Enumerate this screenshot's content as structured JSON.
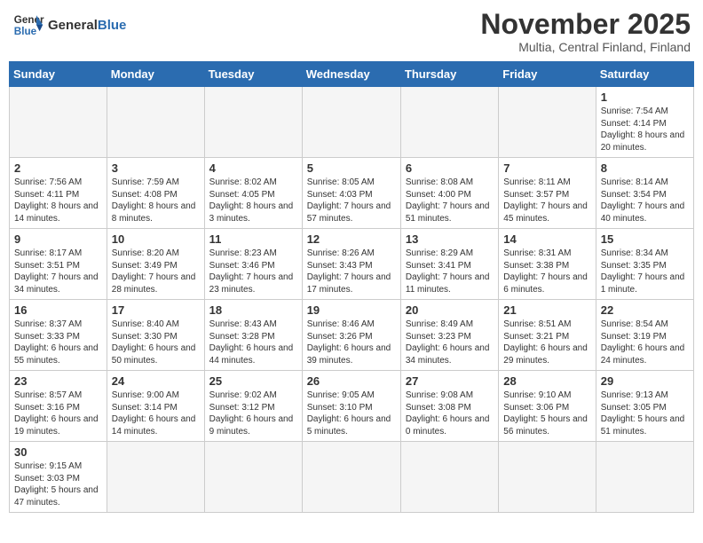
{
  "header": {
    "logo_general": "General",
    "logo_blue": "Blue",
    "month": "November 2025",
    "location": "Multia, Central Finland, Finland"
  },
  "weekdays": [
    "Sunday",
    "Monday",
    "Tuesday",
    "Wednesday",
    "Thursday",
    "Friday",
    "Saturday"
  ],
  "weeks": [
    [
      {
        "day": "",
        "info": ""
      },
      {
        "day": "",
        "info": ""
      },
      {
        "day": "",
        "info": ""
      },
      {
        "day": "",
        "info": ""
      },
      {
        "day": "",
        "info": ""
      },
      {
        "day": "",
        "info": ""
      },
      {
        "day": "1",
        "info": "Sunrise: 7:54 AM\nSunset: 4:14 PM\nDaylight: 8 hours and 20 minutes."
      }
    ],
    [
      {
        "day": "2",
        "info": "Sunrise: 7:56 AM\nSunset: 4:11 PM\nDaylight: 8 hours and 14 minutes."
      },
      {
        "day": "3",
        "info": "Sunrise: 7:59 AM\nSunset: 4:08 PM\nDaylight: 8 hours and 8 minutes."
      },
      {
        "day": "4",
        "info": "Sunrise: 8:02 AM\nSunset: 4:05 PM\nDaylight: 8 hours and 3 minutes."
      },
      {
        "day": "5",
        "info": "Sunrise: 8:05 AM\nSunset: 4:03 PM\nDaylight: 7 hours and 57 minutes."
      },
      {
        "day": "6",
        "info": "Sunrise: 8:08 AM\nSunset: 4:00 PM\nDaylight: 7 hours and 51 minutes."
      },
      {
        "day": "7",
        "info": "Sunrise: 8:11 AM\nSunset: 3:57 PM\nDaylight: 7 hours and 45 minutes."
      },
      {
        "day": "8",
        "info": "Sunrise: 8:14 AM\nSunset: 3:54 PM\nDaylight: 7 hours and 40 minutes."
      }
    ],
    [
      {
        "day": "9",
        "info": "Sunrise: 8:17 AM\nSunset: 3:51 PM\nDaylight: 7 hours and 34 minutes."
      },
      {
        "day": "10",
        "info": "Sunrise: 8:20 AM\nSunset: 3:49 PM\nDaylight: 7 hours and 28 minutes."
      },
      {
        "day": "11",
        "info": "Sunrise: 8:23 AM\nSunset: 3:46 PM\nDaylight: 7 hours and 23 minutes."
      },
      {
        "day": "12",
        "info": "Sunrise: 8:26 AM\nSunset: 3:43 PM\nDaylight: 7 hours and 17 minutes."
      },
      {
        "day": "13",
        "info": "Sunrise: 8:29 AM\nSunset: 3:41 PM\nDaylight: 7 hours and 11 minutes."
      },
      {
        "day": "14",
        "info": "Sunrise: 8:31 AM\nSunset: 3:38 PM\nDaylight: 7 hours and 6 minutes."
      },
      {
        "day": "15",
        "info": "Sunrise: 8:34 AM\nSunset: 3:35 PM\nDaylight: 7 hours and 1 minute."
      }
    ],
    [
      {
        "day": "16",
        "info": "Sunrise: 8:37 AM\nSunset: 3:33 PM\nDaylight: 6 hours and 55 minutes."
      },
      {
        "day": "17",
        "info": "Sunrise: 8:40 AM\nSunset: 3:30 PM\nDaylight: 6 hours and 50 minutes."
      },
      {
        "day": "18",
        "info": "Sunrise: 8:43 AM\nSunset: 3:28 PM\nDaylight: 6 hours and 44 minutes."
      },
      {
        "day": "19",
        "info": "Sunrise: 8:46 AM\nSunset: 3:26 PM\nDaylight: 6 hours and 39 minutes."
      },
      {
        "day": "20",
        "info": "Sunrise: 8:49 AM\nSunset: 3:23 PM\nDaylight: 6 hours and 34 minutes."
      },
      {
        "day": "21",
        "info": "Sunrise: 8:51 AM\nSunset: 3:21 PM\nDaylight: 6 hours and 29 minutes."
      },
      {
        "day": "22",
        "info": "Sunrise: 8:54 AM\nSunset: 3:19 PM\nDaylight: 6 hours and 24 minutes."
      }
    ],
    [
      {
        "day": "23",
        "info": "Sunrise: 8:57 AM\nSunset: 3:16 PM\nDaylight: 6 hours and 19 minutes."
      },
      {
        "day": "24",
        "info": "Sunrise: 9:00 AM\nSunset: 3:14 PM\nDaylight: 6 hours and 14 minutes."
      },
      {
        "day": "25",
        "info": "Sunrise: 9:02 AM\nSunset: 3:12 PM\nDaylight: 6 hours and 9 minutes."
      },
      {
        "day": "26",
        "info": "Sunrise: 9:05 AM\nSunset: 3:10 PM\nDaylight: 6 hours and 5 minutes."
      },
      {
        "day": "27",
        "info": "Sunrise: 9:08 AM\nSunset: 3:08 PM\nDaylight: 6 hours and 0 minutes."
      },
      {
        "day": "28",
        "info": "Sunrise: 9:10 AM\nSunset: 3:06 PM\nDaylight: 5 hours and 56 minutes."
      },
      {
        "day": "29",
        "info": "Sunrise: 9:13 AM\nSunset: 3:05 PM\nDaylight: 5 hours and 51 minutes."
      }
    ],
    [
      {
        "day": "30",
        "info": "Sunrise: 9:15 AM\nSunset: 3:03 PM\nDaylight: 5 hours and 47 minutes."
      },
      {
        "day": "",
        "info": ""
      },
      {
        "day": "",
        "info": ""
      },
      {
        "day": "",
        "info": ""
      },
      {
        "day": "",
        "info": ""
      },
      {
        "day": "",
        "info": ""
      },
      {
        "day": "",
        "info": ""
      }
    ]
  ]
}
